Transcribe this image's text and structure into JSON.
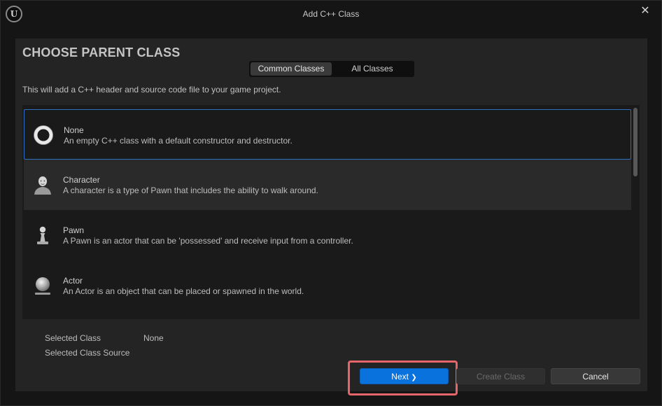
{
  "window": {
    "logo": "U",
    "title": "Add C++ Class",
    "close_glyph": "✕"
  },
  "panel": {
    "heading": "CHOOSE PARENT CLASS",
    "tabs": [
      {
        "label": "Common Classes",
        "active": true
      },
      {
        "label": "All Classes",
        "active": false
      }
    ],
    "subtitle": "This will add a C++ header and source code file to your game project."
  },
  "classes": [
    {
      "name": "None",
      "description": "An empty C++ class with a default constructor and destructor.",
      "icon": "ring-icon",
      "selected": true
    },
    {
      "name": "Character",
      "description": "A character is a type of Pawn that includes the ability to walk around.",
      "icon": "character-icon",
      "selected": false
    },
    {
      "name": "Pawn",
      "description": "A Pawn is an actor that can be 'possessed' and receive input from a controller.",
      "icon": "pawn-icon",
      "selected": false
    },
    {
      "name": "Actor",
      "description": "An Actor is an object that can be placed or spawned in the world.",
      "icon": "actor-sphere-icon",
      "selected": false
    }
  ],
  "info": {
    "selected_class_label": "Selected Class",
    "selected_class_value": "None",
    "selected_class_source_label": "Selected Class Source",
    "selected_class_source_value": ""
  },
  "buttons": {
    "next": "Next",
    "next_glyph": "❯",
    "create": "Create Class",
    "cancel": "Cancel"
  },
  "colors": {
    "accent": "#0a72dc",
    "selection_border": "#2f6fc0",
    "highlight_annotation": "#e4666a"
  }
}
